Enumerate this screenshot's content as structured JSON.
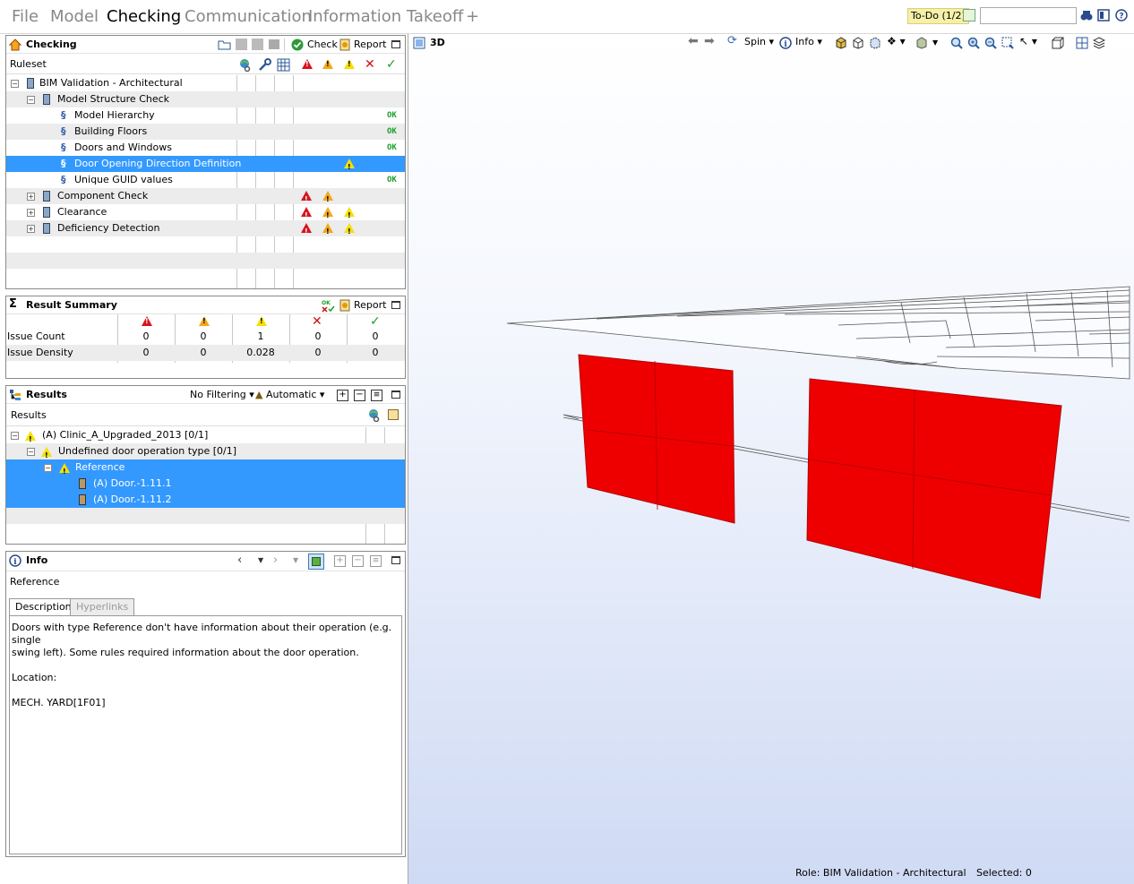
{
  "menu": {
    "tabs": [
      "File",
      "Model",
      "Checking",
      "Communication",
      "Information Takeoff"
    ],
    "active": "Checking",
    "add_tab": "+",
    "todo_label": "To-Do (1/2)",
    "search_value": ""
  },
  "checking_panel": {
    "title": "Checking",
    "check_label": "Check",
    "report_label": "Report",
    "ruleset_header": "Ruleset",
    "tree": [
      {
        "label": "BIM Validation - Architectural",
        "level": 0,
        "expander": "minus",
        "icon": "book",
        "status": []
      },
      {
        "label": "Model Structure Check",
        "level": 1,
        "expander": "minus",
        "icon": "book",
        "status": []
      },
      {
        "label": "Model Hierarchy",
        "level": 2,
        "icon": "rule",
        "status": [
          "OK"
        ]
      },
      {
        "label": "Building Floors",
        "level": 2,
        "icon": "rule",
        "status": [
          "OK"
        ]
      },
      {
        "label": "Doors and Windows",
        "level": 2,
        "icon": "rule",
        "status": [
          "OK"
        ]
      },
      {
        "label": "Door Opening Direction Definition",
        "level": 2,
        "icon": "rule",
        "status": [
          "yellow"
        ],
        "selected": true
      },
      {
        "label": "Unique GUID values",
        "level": 2,
        "icon": "rule",
        "status": [
          "OK"
        ]
      },
      {
        "label": "Component Check",
        "level": 1,
        "expander": "plus",
        "icon": "book",
        "status": [
          "red",
          "orange"
        ]
      },
      {
        "label": "Clearance",
        "level": 1,
        "expander": "plus",
        "icon": "book",
        "status": [
          "red",
          "orange",
          "yellow"
        ]
      },
      {
        "label": "Deficiency Detection",
        "level": 1,
        "expander": "plus",
        "icon": "book",
        "status": [
          "red",
          "orange",
          "yellow"
        ]
      }
    ],
    "ok_text": "OK",
    "rule_symbol": "§"
  },
  "result_summary": {
    "title": "Result Summary",
    "report_label": "Report",
    "rows": [
      {
        "label": "Issue Count",
        "values": [
          "0",
          "0",
          "1",
          "0",
          "0"
        ]
      },
      {
        "label": "Issue Density",
        "values": [
          "0",
          "0",
          "0.028",
          "0",
          "0"
        ]
      }
    ]
  },
  "results_panel": {
    "title": "Results",
    "filter_label": "No Filtering",
    "mode_label": "Automatic",
    "column_header": "Results",
    "tree": [
      {
        "label": "(A) Clinic_A_Upgraded_2013 [0/1]",
        "level": 0
      },
      {
        "label": "Undefined door operation type [0/1]",
        "level": 1
      },
      {
        "label": "Reference",
        "level": 2
      },
      {
        "label": "(A) Door.-1.11.1",
        "level": 3
      },
      {
        "label": "(A) Door.-1.11.2",
        "level": 3
      }
    ]
  },
  "info_panel": {
    "title": "Info",
    "heading": "Reference",
    "tabs": [
      "Description",
      "Hyperlinks"
    ],
    "description_lines": [
      "Doors with type Reference don't have information about their operation (e.g. single",
      "swing left). Some rules required information about the door operation.",
      "",
      "Location:",
      "",
      "MECH. YARD[1F01]"
    ]
  },
  "viewport": {
    "title": "3D",
    "spin_label": "Spin",
    "info_label": "Info",
    "status_role": "Role: BIM Validation - Architectural",
    "status_selected": "Selected: 0",
    "highlight_color": "#ee0000"
  }
}
